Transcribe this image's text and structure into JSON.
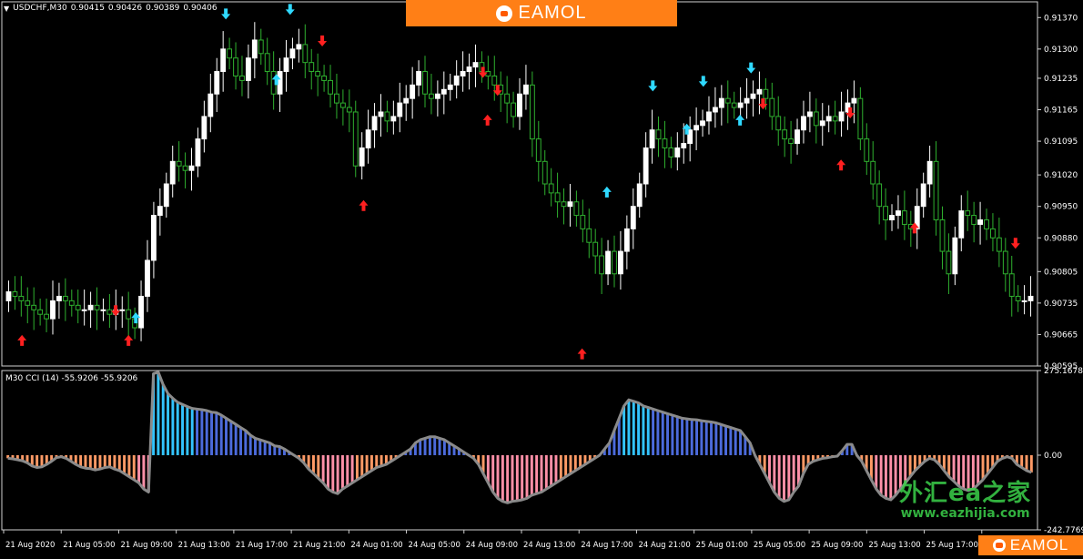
{
  "chart_header": {
    "symbol_timeframe": "USDCHF,M30",
    "open": "0.90415",
    "high": "0.90426",
    "low": "0.90389",
    "close": "0.90406"
  },
  "indicator_header": "M30 CCI (14) -55.9206 -55.9206",
  "brand": {
    "top_text": "EAMOL",
    "bottom_text": "EAMOL",
    "color": "#ff7f16"
  },
  "watermark": {
    "line1": "外汇ea之家",
    "line2": "www.eazhijia.com"
  },
  "colors": {
    "background": "#000000",
    "bull_candle": "#ffffff",
    "bear_candle": "#2fb12f",
    "cci_above_strong": "#33c4ff",
    "cci_above": "#4c6bdc",
    "cci_below": "#ff9a66",
    "cci_below_strong": "#ff90a8",
    "cci_line": "#8a8a8a",
    "arrow_up_red": "#ff2020",
    "arrow_cyan": "#2fd9ff"
  },
  "chart_data": [
    {
      "type": "candlestick",
      "ylim": [
        0.90595,
        0.91405
      ],
      "price_ticks": [
        "0.91370",
        "0.91300",
        "0.91235",
        "0.91165",
        "0.91095",
        "0.91020",
        "0.90950",
        "0.90880",
        "0.90805",
        "0.90735",
        "0.90665",
        "0.90595"
      ],
      "x_tick_labels": [
        "21 Aug 2020",
        "21 Aug 05:00",
        "21 Aug 09:00",
        "21 Aug 13:00",
        "21 Aug 17:00",
        "21 Aug 21:00",
        "24 Aug 01:00",
        "24 Aug 05:00",
        "24 Aug 09:00",
        "24 Aug 13:00",
        "24 Aug 17:00",
        "24 Aug 21:00",
        "25 Aug 01:00",
        "25 Aug 05:00",
        "25 Aug 09:00",
        "25 Aug 13:00",
        "25 Aug 17:00",
        "25 Aug 21:00"
      ],
      "close_path": [
        0.9076,
        0.9075,
        0.9074,
        0.9073,
        0.9072,
        0.9071,
        0.907,
        0.9074,
        0.9075,
        0.9074,
        0.9073,
        0.9072,
        0.9072,
        0.9073,
        0.9072,
        0.9072,
        0.9071,
        0.9072,
        0.9072,
        0.907,
        0.9068,
        0.9075,
        0.9083,
        0.9093,
        0.9095,
        0.91,
        0.9105,
        0.9104,
        0.9103,
        0.9104,
        0.911,
        0.9115,
        0.912,
        0.9125,
        0.913,
        0.9128,
        0.9124,
        0.9123,
        0.9128,
        0.9132,
        0.9129,
        0.9125,
        0.912,
        0.9125,
        0.9128,
        0.913,
        0.9131,
        0.9127,
        0.9125,
        0.9124,
        0.9123,
        0.912,
        0.9118,
        0.9117,
        0.9116,
        0.9104,
        0.9108,
        0.9112,
        0.9115,
        0.9116,
        0.9114,
        0.9115,
        0.9118,
        0.9119,
        0.9122,
        0.9125,
        0.912,
        0.9119,
        0.912,
        0.9121,
        0.9122,
        0.9124,
        0.9125,
        0.9126,
        0.9127,
        0.9125,
        0.9124,
        0.9122,
        0.912,
        0.9118,
        0.9115,
        0.912,
        0.9122,
        0.911,
        0.9105,
        0.91,
        0.9098,
        0.9096,
        0.9095,
        0.9096,
        0.9093,
        0.909,
        0.9087,
        0.9084,
        0.908,
        0.9085,
        0.908,
        0.9085,
        0.909,
        0.9095,
        0.91,
        0.9108,
        0.9112,
        0.911,
        0.9108,
        0.9106,
        0.9108,
        0.9109,
        0.9112,
        0.9113,
        0.9114,
        0.9116,
        0.9117,
        0.9119,
        0.9118,
        0.9117,
        0.9118,
        0.9119,
        0.912,
        0.9121,
        0.9119,
        0.9115,
        0.9112,
        0.911,
        0.9109,
        0.9112,
        0.9115,
        0.9116,
        0.9113,
        0.9114,
        0.9115,
        0.9114,
        0.9116,
        0.9118,
        0.9119,
        0.911,
        0.9105,
        0.91,
        0.9095,
        0.9092,
        0.9093,
        0.9094,
        0.9091,
        0.909,
        0.9095,
        0.91,
        0.9105,
        0.9092,
        0.9085,
        0.908,
        0.9088,
        0.9094,
        0.9093,
        0.9091,
        0.9092,
        0.909,
        0.9088,
        0.9085,
        0.908,
        0.9075,
        0.9074,
        0.9074,
        0.9075
      ]
    },
    {
      "type": "bar",
      "series_name": "M30 CCI (14)",
      "ylim": [
        -242.7769,
        275.1678
      ],
      "value_ticks": [
        "275.1678",
        "0.00",
        "-242.7769"
      ],
      "values": [
        -10,
        -12,
        -15,
        -18,
        -25,
        -35,
        -40,
        -38,
        -30,
        -20,
        -8,
        -5,
        -10,
        -20,
        -30,
        -38,
        -42,
        -44,
        -48,
        -45,
        -40,
        -38,
        -45,
        -50,
        -60,
        -70,
        -80,
        -90,
        -110,
        -120,
        265,
        270,
        230,
        200,
        185,
        172,
        165,
        158,
        152,
        150,
        148,
        145,
        140,
        138,
        130,
        120,
        110,
        100,
        90,
        80,
        65,
        55,
        50,
        45,
        40,
        30,
        28,
        20,
        10,
        0,
        -10,
        -25,
        -45,
        -60,
        -75,
        -90,
        -110,
        -120,
        -125,
        -110,
        -100,
        -90,
        -80,
        -70,
        -60,
        -50,
        -40,
        -35,
        -30,
        -20,
        -10,
        0,
        10,
        20,
        40,
        50,
        55,
        60,
        60,
        55,
        50,
        40,
        30,
        20,
        10,
        0,
        -10,
        -30,
        -60,
        -90,
        -120,
        -140,
        -150,
        -155,
        -150,
        -148,
        -145,
        -140,
        -130,
        -125,
        -120,
        -110,
        -100,
        -90,
        -80,
        -70,
        -60,
        -50,
        -40,
        -30,
        -20,
        -10,
        0,
        20,
        40,
        80,
        120,
        160,
        180,
        175,
        170,
        160,
        155,
        150,
        145,
        140,
        135,
        130,
        125,
        120,
        118,
        116,
        115,
        112,
        110,
        108,
        105,
        100,
        95,
        90,
        85,
        80,
        60,
        40,
        0,
        -30,
        -60,
        -90,
        -120,
        -140,
        -150,
        -145,
        -120,
        -100,
        -60,
        -30,
        -20,
        -15,
        -10,
        -8,
        -5,
        -3,
        15,
        35,
        35,
        0,
        -20,
        -50,
        -80,
        -110,
        -130,
        -140,
        -145,
        -130,
        -110,
        -90,
        -70,
        -50,
        -35,
        -20,
        -10,
        -15,
        -30,
        -50,
        -70,
        -85,
        -100,
        -110,
        -115,
        -110,
        -95,
        -80,
        -60,
        -40,
        -20,
        -10,
        -5,
        -10,
        -30,
        -40,
        -50,
        -56
      ]
    }
  ],
  "signals": {
    "red_up": [
      [
        0.18,
        0.9065
      ],
      [
        1.34,
        0.9065
      ],
      [
        3.9,
        0.9095
      ],
      [
        6.28,
        0.9062
      ],
      [
        9.1,
        0.9104
      ],
      [
        9.9,
        0.909
      ],
      [
        5.25,
        0.9114
      ]
    ],
    "red_down": [
      [
        1.2,
        0.9072
      ],
      [
        3.45,
        0.9132
      ],
      [
        5.2,
        0.9125
      ],
      [
        5.36,
        0.9121
      ],
      [
        8.25,
        0.9118
      ],
      [
        9.2,
        0.9116
      ],
      [
        11.0,
        0.9087
      ]
    ],
    "cyan_up": [
      [
        1.42,
        0.907
      ],
      [
        2.95,
        0.9123
      ],
      [
        6.55,
        0.9098
      ],
      [
        7.42,
        0.9112
      ],
      [
        8.0,
        0.9114
      ]
    ],
    "cyan_down": [
      [
        2.4,
        0.9138
      ],
      [
        3.1,
        0.9139
      ],
      [
        7.05,
        0.9122
      ],
      [
        7.6,
        0.9123
      ],
      [
        8.12,
        0.9126
      ]
    ]
  }
}
